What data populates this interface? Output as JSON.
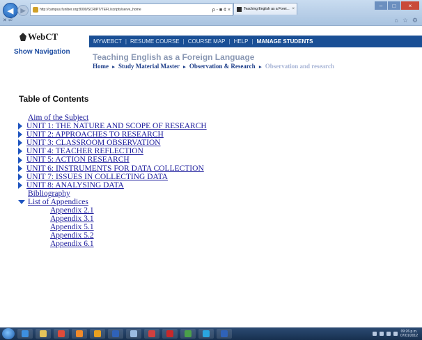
{
  "browser": {
    "url": "http://campus.funiber.org:8000/SCRIPT/TEFL/scripts/serve_home",
    "tab_title": "Teaching English as a Forei...",
    "tab_close": "×",
    "address_controls": "ρ - ■ ¢ ×",
    "window_controls": {
      "minimize": "–",
      "maximize": "□",
      "close": "×"
    }
  },
  "header": {
    "logo_text": "WebCT",
    "show_navigation": "Show Navigation",
    "topnav": [
      {
        "label": "MYWEBCT",
        "active": false
      },
      {
        "label": "RESUME COURSE",
        "active": false
      },
      {
        "label": "COURSE MAP",
        "active": false
      },
      {
        "label": "HELP",
        "active": false
      },
      {
        "label": "MANAGE STUDENTS",
        "active": true
      }
    ],
    "topnav_separator": "|",
    "course_title": "Teaching English as a Foreign Language",
    "breadcrumb": [
      {
        "label": "Home"
      },
      {
        "label": "Study Material Master"
      },
      {
        "label": "Observation & Research"
      },
      {
        "label": "Observation and research",
        "current": true
      }
    ],
    "breadcrumb_arrow": "▸"
  },
  "toc": {
    "heading": "Table of Contents",
    "items": [
      {
        "label": "Aim of the Subject",
        "marker": "none",
        "level": 0
      },
      {
        "label": "UNIT 1: THE NATURE AND SCOPE OF RESEARCH",
        "marker": "collapsed",
        "level": 0
      },
      {
        "label": "UNIT 2: APPROACHES TO RESEARCH",
        "marker": "collapsed",
        "level": 0
      },
      {
        "label": "UNIT 3: CLASSROOM OBSERVATION",
        "marker": "collapsed",
        "level": 0
      },
      {
        "label": "UNIT 4: TEACHER REFLECTION",
        "marker": "collapsed",
        "level": 0
      },
      {
        "label": "UNIT 5: ACTION RESEARCH",
        "marker": "collapsed",
        "level": 0
      },
      {
        "label": "UNIT 6: INSTRUMENTS FOR DATA COLLECTION",
        "marker": "collapsed",
        "level": 0
      },
      {
        "label": "UNIT 7: ISSUES IN COLLECTING DATA",
        "marker": "collapsed",
        "level": 0
      },
      {
        "label": "UNIT 8: ANALYSING DATA",
        "marker": "collapsed",
        "level": 0
      },
      {
        "label": "Bibliography",
        "marker": "none",
        "level": 0
      },
      {
        "label": "List of Appendices",
        "marker": "expanded",
        "level": 0
      },
      {
        "label": "Appendix 2.1",
        "marker": "none",
        "level": 1
      },
      {
        "label": "Appendix 3.1",
        "marker": "none",
        "level": 1
      },
      {
        "label": "Appendix 5.1",
        "marker": "none",
        "level": 1
      },
      {
        "label": "Appendix 5.2",
        "marker": "none",
        "level": 1
      },
      {
        "label": "Appendix 6.1",
        "marker": "none",
        "level": 1
      }
    ]
  },
  "taskbar": {
    "apps": [
      {
        "name": "internet-explorer",
        "color": "#3d8fe0"
      },
      {
        "name": "file-explorer",
        "color": "#e6c55a"
      },
      {
        "name": "chrome",
        "color": "#e04b3a"
      },
      {
        "name": "firefox",
        "color": "#f08a2a"
      },
      {
        "name": "media-player",
        "color": "#e8a020"
      },
      {
        "name": "word",
        "color": "#2f62b8"
      },
      {
        "name": "notes",
        "color": "#9bbbe0"
      },
      {
        "name": "paint",
        "color": "#d04040"
      },
      {
        "name": "adobe-reader",
        "color": "#c8282a"
      },
      {
        "name": "spreadsheet",
        "color": "#4aa04a"
      },
      {
        "name": "skype",
        "color": "#2aa6e0"
      },
      {
        "name": "word-doc",
        "color": "#2f62b8"
      }
    ],
    "clock_time": "09:26 p.m.",
    "clock_date": "07/01/2012"
  }
}
